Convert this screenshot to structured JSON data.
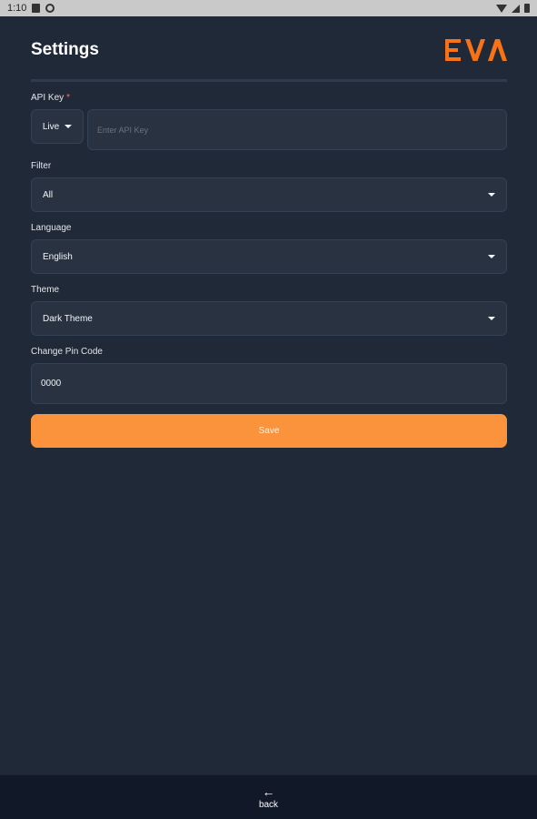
{
  "status_bar": {
    "time": "1:10"
  },
  "header": {
    "title": "Settings",
    "logo_text": "EVA",
    "accent_color": "#f97316"
  },
  "api_key": {
    "label": "API Key",
    "required_mark": "*",
    "mode_value": "Live",
    "placeholder": "Enter API Key"
  },
  "filter": {
    "label": "Filter",
    "value": "All"
  },
  "language": {
    "label": "Language",
    "value": "English"
  },
  "theme": {
    "label": "Theme",
    "value": "Dark Theme"
  },
  "pin": {
    "label": "Change Pin Code",
    "value": "0000"
  },
  "save_label": "Save",
  "bottom_nav": {
    "back_label": "back",
    "back_icon": "arrow-left-icon"
  }
}
